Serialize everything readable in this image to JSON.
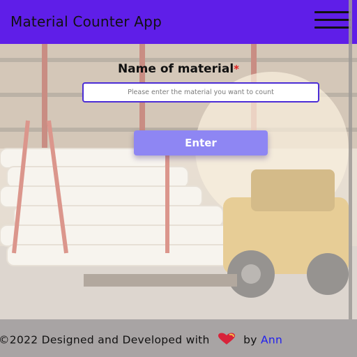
{
  "header": {
    "title": "Material Counter App",
    "menu_icon": "hamburger-menu-icon"
  },
  "form": {
    "label": "Name of material",
    "required_mark": "*",
    "input_placeholder": "Please enter the material you want to count",
    "input_value": "",
    "submit_label": "Enter"
  },
  "footer": {
    "text_before": "©2022 Designed and Developed with",
    "heart_icon": "heart-icon",
    "text_by": "by",
    "author_link": "Ann"
  },
  "colors": {
    "header_bg": "#5f1ee8",
    "button_bg": "#8e86f3",
    "input_border": "#4b2dd6",
    "link": "#2020ee",
    "required": "#e02020",
    "footer_bg": "#a8a4a4"
  }
}
